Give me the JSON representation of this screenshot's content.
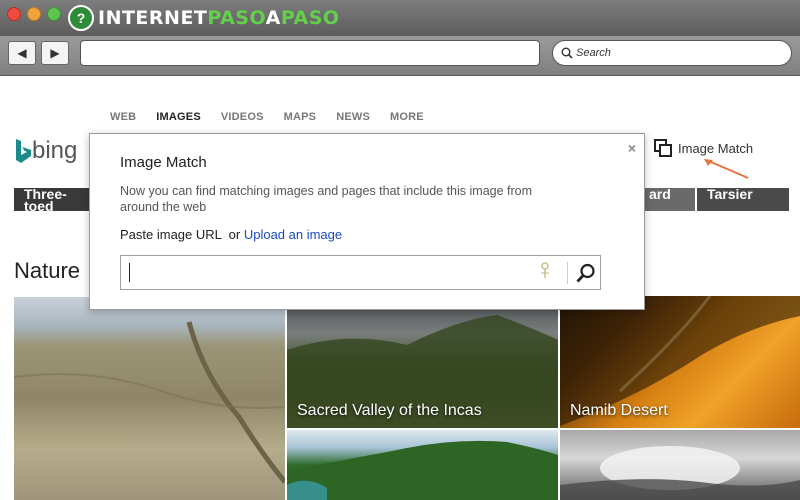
{
  "browser": {
    "brand": {
      "part1": "INTERNET",
      "part2": "PASO",
      "part3": "A",
      "part4": "PASO"
    },
    "back_icon": "◀",
    "forward_icon": "▶",
    "search_placeholder": "Search"
  },
  "bing": {
    "nav": [
      "WEB",
      "IMAGES",
      "VIDEOS",
      "MAPS",
      "NEWS",
      "MORE"
    ],
    "active_nav": "IMAGES",
    "logo_text": "bing",
    "image_match_label": "Image Match",
    "strip_left": "Three-toed",
    "strip_mid": "ard",
    "strip_right": "Tarsier",
    "section_title": "Nature",
    "tiles": [
      {
        "caption": ""
      },
      {
        "caption": "Sacred Valley of the Incas"
      },
      {
        "caption": "Namib Desert"
      },
      {
        "caption": ""
      },
      {
        "caption": ""
      }
    ]
  },
  "dialog": {
    "title": "Image Match",
    "description": "Now you can find matching images and pages that include this image from around the web",
    "paste_label": "Paste image URL",
    "or_text": "or",
    "upload_link": "Upload an image",
    "close_icon": "×",
    "input_value": ""
  },
  "colors": {
    "link": "#1a4bbd",
    "annotation_arrow": "#e8743b",
    "bing_teal": "#1a8a8a"
  }
}
